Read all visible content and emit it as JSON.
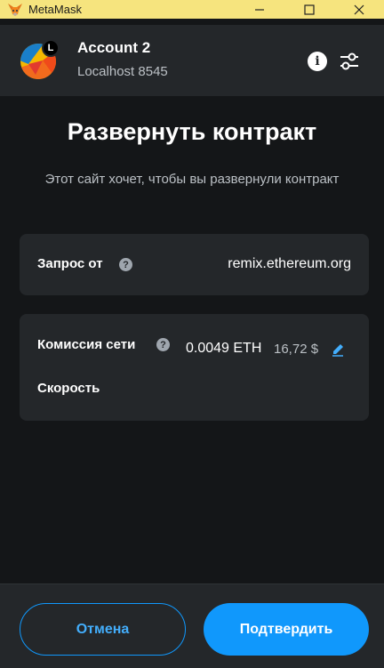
{
  "window": {
    "title": "MetaMask"
  },
  "header": {
    "account_name": "Account 2",
    "account_badge": "L",
    "network": "Localhost 8545",
    "info_glyph": "i"
  },
  "main": {
    "title": "Развернуть контракт",
    "subtitle": "Этот сайт хочет, чтобы вы развернули контракт",
    "origin": {
      "label": "Запрос от",
      "value": "remix.ethereum.org"
    },
    "fee": {
      "label": "Комиссия сети",
      "eth": "0.0049 ETH",
      "fiat": "16,72 $",
      "speed_label": "Скорость"
    }
  },
  "footer": {
    "cancel_label": "Отмена",
    "confirm_label": "Подтвердить"
  },
  "icons": {
    "app": "metamask-fox-icon",
    "minimize": "minimize-icon",
    "maximize": "maximize-icon",
    "close": "close-icon",
    "info": "info-icon",
    "settings": "sliders-icon",
    "help": "question-icon",
    "edit": "pencil-icon"
  },
  "colors": {
    "accent": "#1098fc",
    "background": "#141618",
    "surface": "#24272a",
    "titlebar": "#f6e47e",
    "muted": "#bbc0c5"
  }
}
